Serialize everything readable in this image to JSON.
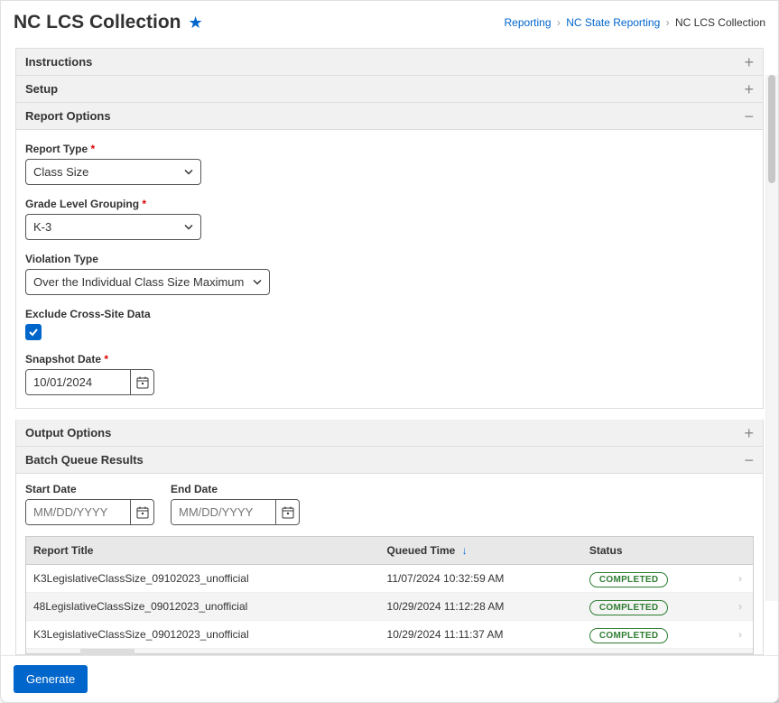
{
  "header": {
    "title": "NC LCS Collection"
  },
  "breadcrumb": {
    "item1": "Reporting",
    "item2": "NC State Reporting",
    "item3": "NC LCS Collection"
  },
  "accordions": {
    "instructions": "Instructions",
    "setup": "Setup",
    "report_options": "Report Options",
    "output_options": "Output Options",
    "batch_queue": "Batch Queue Results"
  },
  "fields": {
    "report_type_label": "Report Type",
    "report_type_value": "Class Size",
    "grade_grouping_label": "Grade Level Grouping",
    "grade_grouping_value": "K-3",
    "violation_type_label": "Violation Type",
    "violation_type_value": "Over the Individual Class Size Maximum",
    "exclude_cross_site_label": "Exclude Cross-Site Data",
    "snapshot_date_label": "Snapshot Date",
    "snapshot_date_value": "10/01/2024"
  },
  "batch": {
    "start_date_label": "Start Date",
    "start_date_placeholder": "MM/DD/YYYY",
    "end_date_label": "End Date",
    "end_date_placeholder": "MM/DD/YYYY",
    "columns": {
      "title": "Report Title",
      "queued": "Queued Time",
      "status": "Status"
    },
    "rows": [
      {
        "title": "K3LegislativeClassSize_09102023_unofficial",
        "queued": "11/07/2024 10:32:59 AM",
        "status": "COMPLETED"
      },
      {
        "title": "48LegislativeClassSize_09012023_unofficial",
        "queued": "10/29/2024 11:12:28 AM",
        "status": "COMPLETED"
      },
      {
        "title": "K3LegislativeClassSize_09012023_unofficial",
        "queued": "10/29/2024 11:11:37 AM",
        "status": "COMPLETED"
      }
    ]
  },
  "footer": {
    "generate": "Generate"
  }
}
